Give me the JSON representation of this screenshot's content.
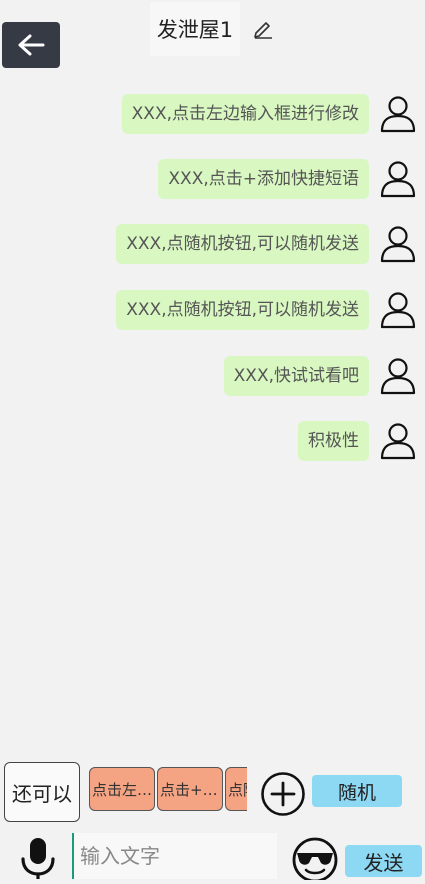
{
  "header": {
    "title": "发泄屋1"
  },
  "messages": [
    {
      "text": "XXX,点击左边输入框进行修改"
    },
    {
      "text": "XXX,点击+添加快捷短语"
    },
    {
      "text": "XXX,点随机按钮,可以随机发送"
    },
    {
      "text": "XXX,点随机按钮,可以随机发送"
    },
    {
      "text": "XXX,快试试看吧"
    },
    {
      "text": "积极性"
    }
  ],
  "quick_bar": {
    "quick_label": "还可以",
    "chips": [
      "点击左边输入框进行修改",
      "点击+添加快捷短语",
      "点随机按钮,可以随机发送"
    ],
    "random_label": "随机"
  },
  "input_bar": {
    "placeholder": "输入文字",
    "send_label": "发送"
  },
  "icons": {
    "back": "arrow-left-icon",
    "edit": "pencil-icon",
    "avatar": "user-icon",
    "add": "plus-circle-icon",
    "mic": "microphone-icon",
    "emoji": "sunglasses-emoji-icon"
  },
  "colors": {
    "bubble": "#d8f7c1",
    "chip": "#f4a383",
    "accent_button": "#8dd8f3",
    "back_button": "#363a44"
  }
}
